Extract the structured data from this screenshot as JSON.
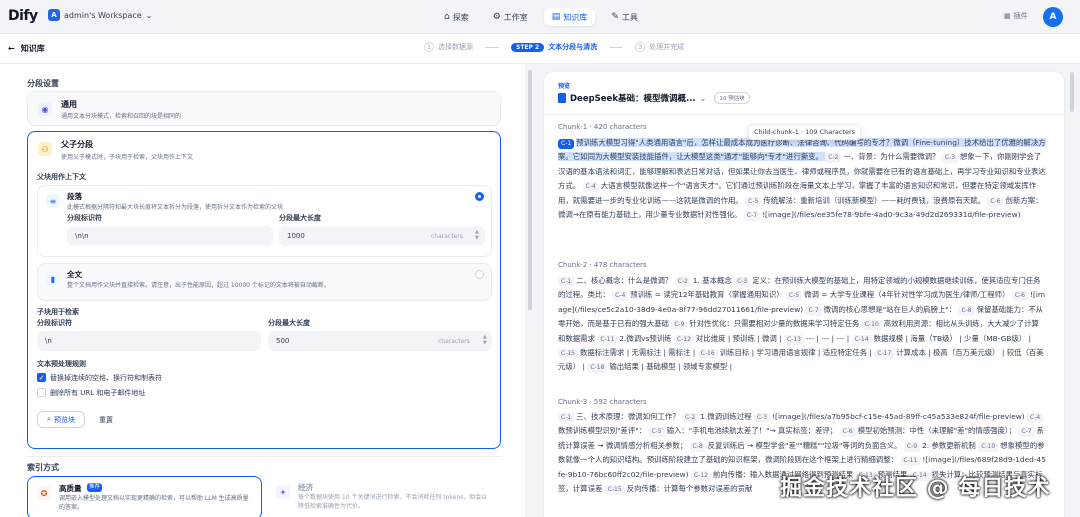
{
  "app": {
    "logo": "Dify",
    "workspace_initial": "A",
    "workspace": "admin's Workspace"
  },
  "nav": [
    {
      "icon": "explore-icon",
      "glyph": "⌂",
      "label": "探索"
    },
    {
      "icon": "studio-icon",
      "glyph": "⚙",
      "label": "工作室"
    },
    {
      "icon": "knowledge-icon",
      "glyph": "▤",
      "label": "知识库"
    },
    {
      "icon": "tools-icon",
      "glyph": "✎",
      "label": "工具"
    }
  ],
  "plugin_label": "插件",
  "avatar": "A",
  "subbar": {
    "back_label": "知识库",
    "steps": [
      {
        "num": "1",
        "label": "选择数据源"
      },
      {
        "pill": "STEP 2",
        "label": "文本分段与清洗"
      },
      {
        "num": "3",
        "label": "处理并完成"
      }
    ]
  },
  "left": {
    "segment_title": "分段设置",
    "general": {
      "title": "通用",
      "desc": "通用文本分块模式，检索和召回的块是相同的"
    },
    "parent_child": {
      "title": "父子分段",
      "desc": "使用父子模式时，子块用于检索，父块用作上下文",
      "parent_ctx_label": "父块用作上下文",
      "paragraph": {
        "title": "段落",
        "desc": "此模式根据分隔符和最大块长度将文本拆分为段落，使用拆分文本作为检索的父块",
        "sep_label": "分段标识符",
        "sep_value": "\\n\\n",
        "max_label": "分段最大长度",
        "max_value": "1000",
        "unit": "characters"
      },
      "fulldoc": {
        "title": "全文",
        "desc": "整个文档用作父块并直接检索。请注意，出于性能原因，超过 10000 个标记的文本将被自动截断。"
      },
      "child_label": "子块用于检索",
      "child_sep_label": "分段标识符",
      "child_sep_value": "\\n",
      "child_max_label": "分段最大长度",
      "child_max_value": "500",
      "child_unit": "characters",
      "preprocess_label": "文本预处理规则",
      "rule1": "替换掉连续的空格、换行符和制表符",
      "rule2": "删除所有 URL 和电子邮件地址",
      "preview_btn": "预览块",
      "reset_btn": "重置"
    },
    "index_title": "索引方式",
    "high_quality": {
      "title": "高质量",
      "badge": "推荐",
      "desc": "调用嵌入模型处理文档以实现更精确的检索，可以帮助 LLM 生成高质量的答案。"
    },
    "economy": {
      "title": "经济",
      "desc": "每个数据块使用 10 个关键词进行检索，不会消耗任何 tokens，但会以降低检索准确性为代价。"
    }
  },
  "preview": {
    "label": "预览",
    "doc_title": "DeepSeek基础：模型微调概...",
    "count": "10 预估块",
    "tooltip": "Child-chunk-1 · 109 Characters",
    "chunks": [
      {
        "head": "Chunk-1 · 420 characters",
        "segs": [
          {
            "tag": "C-1",
            "text": "预训练大模型习得\"人类通用语言\"后，怎样让最成本成为医疗诊断、法律咨询、代码编写的专才？微调（Fine-tuning）技术给出了优雅的解决方案。它如同为大模型安装技能插件，让大模型这类\"通才\"能够向\"专才\"进行撕变。",
            "hl": true
          },
          {
            "tag": "C-2",
            "text": "一、背景：为什么需要微调？"
          },
          {
            "tag": "C-3",
            "text": "想象一下，你刚刚学会了汉语的基本语法和词汇，能够理解和表达日常对话，但如果让你去当医生、律师或程序员，你就需要在已有的语言基础上，再学习专业知识和专业表达方式。"
          },
          {
            "tag": "C-4",
            "text": "大语言模型就像这样一个\"语言天才\"。它们通过预训练阶段在海量文本上学习，掌握了丰富的语言知识和常识，但要在特定领域发挥作用，就需要进一步的专业化训练——这就是微调的作用。"
          },
          {
            "tag": "C-5",
            "text": "传统解法：重新培训（训练新模型）——耗时费钱，浪费原有天赋。"
          },
          {
            "tag": "C-6",
            "text": "创新方案：微调→在原有能力基础上，用少量专业数据针对性强化。"
          },
          {
            "tag": "C-7",
            "text": "![image](/files/ee35fe78-9bfe-4ad0-9c3a-49d2d269331d/file-preview)"
          }
        ]
      },
      {
        "head": "Chunk-2 · 478 characters",
        "segs": [
          {
            "tag": "C-1",
            "text": "二、核心概念：什么是微调？"
          },
          {
            "tag": "C-2",
            "text": "1. 基本概念"
          },
          {
            "tag": "C-3",
            "text": "定义：在预训练大模型的基础上，用特定领域的小规模数据继续训练，使其适应专门任务的过程。类比："
          },
          {
            "tag": "C-4",
            "text": "预训练 = 读完12年基础教育（掌握通用知识）"
          },
          {
            "tag": "C-5",
            "text": "微调 = 大学专业课程（4年针对性学习成为医生/律师/工程师）"
          },
          {
            "tag": "C-6",
            "text": "![image](/files/ce5c2a10-38d9-4e0a-8f77-96dd27011661/file-preview)"
          },
          {
            "tag": "C-7",
            "text": "微调的核心思想是\"站在巨人的肩膀上\"："
          },
          {
            "tag": "C-8",
            "text": "保留基础能力：不从零开始，而是基于已有的强大基础"
          },
          {
            "tag": "C-9",
            "text": "针对性优化：只需要相对少量的数据来学习特定任务"
          },
          {
            "tag": "C-10",
            "text": "高效利用资源：相比从头训练，大大减少了计算和数据需求"
          },
          {
            "tag": "C-11",
            "text": "2.微调vs预训练"
          },
          {
            "tag": "C-12",
            "text": "对比维度 | 预训练 | 微调 |"
          },
          {
            "tag": "C-13",
            "text": "--- | --- | --- |"
          },
          {
            "tag": "C-14",
            "text": "数据规模 | 海量（TB级） | 少量（MB-GB级） |"
          },
          {
            "tag": "C-15",
            "text": "数据标注需求 | 无需标注 | 需标注 |"
          },
          {
            "tag": "C-16",
            "text": "训练目标 | 学习通用语言规律 | 适应特定任务 |"
          },
          {
            "tag": "C-17",
            "text": "计算成本 | 极高（百万美元级） | 较低（百美元级） |"
          },
          {
            "tag": "C-18",
            "text": "输出结果 | 基础模型 | 领域专家模型 |"
          }
        ]
      },
      {
        "head": "Chunk-3 · 592 characters",
        "segs": [
          {
            "tag": "C-1",
            "text": "三、技术原理：微调如何工作？"
          },
          {
            "tag": "C-2",
            "text": "1.微调训练过程"
          },
          {
            "tag": "C-3",
            "text": "![image](/files/a7b95bcf-c15e-45ad-89ff-c45a533e824f/file-preview)"
          },
          {
            "tag": "C-4",
            "text": "数预训练模型识别\"差评\"："
          },
          {
            "tag": "C-5",
            "text": "输入：\"手机电池续航太差了！\"→ 真实标签：差评；"
          },
          {
            "tag": "C-6",
            "text": "模型初始预测：中性（未理解\"差\"的情感强度）；"
          },
          {
            "tag": "C-7",
            "text": "系统计算误差 → 微调情感分析相关参数；"
          },
          {
            "tag": "C-8",
            "text": "反复训练后 → 模型学会\"差\"\"糟糕\"\"垃圾\"等词的负面含义。"
          },
          {
            "tag": "C-9",
            "text": "2. 参数更新机制"
          },
          {
            "tag": "C-10",
            "text": "想象模型的参数就像一个人的知识结构。预训练阶段建立了基础的知识框架，微调阶段则在这个框架上进行精细调整："
          },
          {
            "tag": "C-11",
            "text": "![image](/files/689f28d9-1ded-45fe-9b10-76bc60ff2c02/file-preview)"
          },
          {
            "tag": "C-12",
            "text": "前向传播：输入数据通过网络得到预测结果"
          },
          {
            "tag": "C-13",
            "text": "预测结果"
          },
          {
            "tag": "C-14",
            "text": "损失计算：比较预测结果与真实标签，计算误差"
          },
          {
            "tag": "C-15",
            "text": "反向传播：计算每个参数对误差的贡献"
          }
        ]
      }
    ]
  },
  "watermark": "掘金技术社区 @ 每日技术"
}
